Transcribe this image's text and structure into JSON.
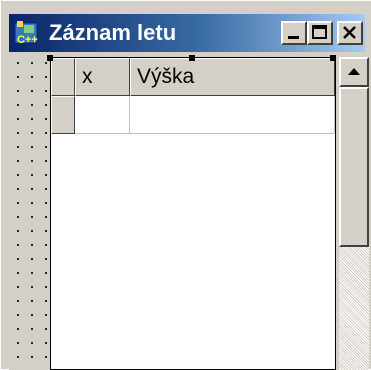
{
  "window": {
    "title": "Záznam letu",
    "icon": "cpp-builder-app-icon",
    "controls": {
      "minimize_icon": "minimize-icon",
      "maximize_icon": "maximize-icon",
      "close_icon": "close-icon"
    },
    "colors": {
      "titlebar_start": "#0a246a",
      "titlebar_end": "#a6caf0",
      "face": "#d4d0c8"
    }
  },
  "grid": {
    "columns": [
      {
        "label": ""
      },
      {
        "label": "x"
      },
      {
        "label": "Výška"
      }
    ],
    "rows": [
      {
        "cells": [
          "",
          "",
          ""
        ]
      }
    ]
  },
  "scrollbar": {
    "up_icon": "scroll-up-arrow-icon"
  }
}
